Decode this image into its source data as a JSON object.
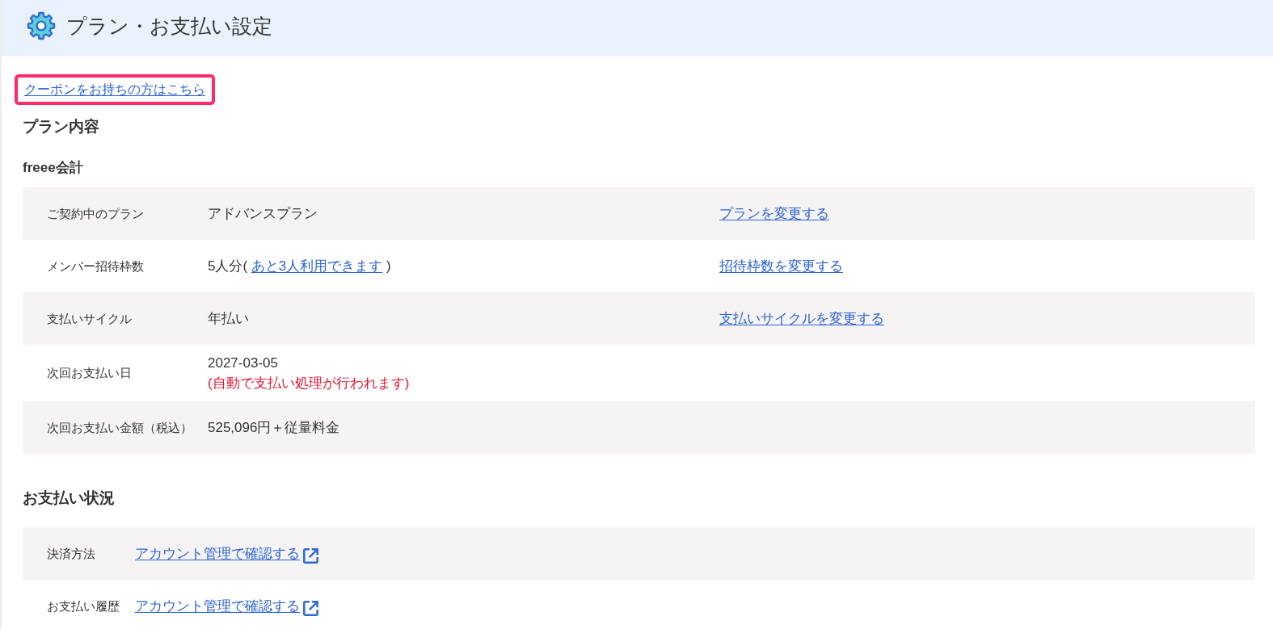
{
  "header": {
    "title": "プラン・お支払い設定"
  },
  "coupon_link": {
    "text": "クーポンをお持ちの方はこちら",
    "highlighted": true
  },
  "sections": [
    {
      "heading": "プラン内容",
      "subheading": "freee会計",
      "rows": [
        {
          "label": "ご契約中のプラン",
          "value": [
            {
              "kind": "text",
              "text": "アドバンスプラン"
            }
          ],
          "action": "プランを変更する"
        },
        {
          "label": "メンバー招待枠数",
          "value": [
            {
              "kind": "text_with_link",
              "text": "5人分( ",
              "link": "あと3人利用できます",
              "after": " )"
            }
          ],
          "action": "招待枠数を変更する"
        },
        {
          "label": "支払いサイクル",
          "value": [
            {
              "kind": "text",
              "text": "年払い"
            }
          ],
          "action": "支払いサイクルを変更する"
        },
        {
          "label": "次回お支払い日",
          "value": [
            {
              "kind": "text",
              "text": "2027-03-05"
            },
            {
              "kind": "note",
              "text": "(自動で支払い処理が行われます)"
            }
          ]
        },
        {
          "label": "次回お支払い金額（税込）",
          "value": [
            {
              "kind": "text",
              "text": "525,096円＋従量料金"
            }
          ]
        }
      ]
    },
    {
      "heading": "お支払い状況",
      "rows": [
        {
          "label": "決済方法",
          "value": [
            {
              "kind": "external_link",
              "text": "アカウント管理で確認する"
            }
          ]
        },
        {
          "label": "お支払い履歴",
          "value": [
            {
              "kind": "external_link",
              "text": "アカウント管理で確認する"
            }
          ]
        }
      ]
    }
  ]
}
